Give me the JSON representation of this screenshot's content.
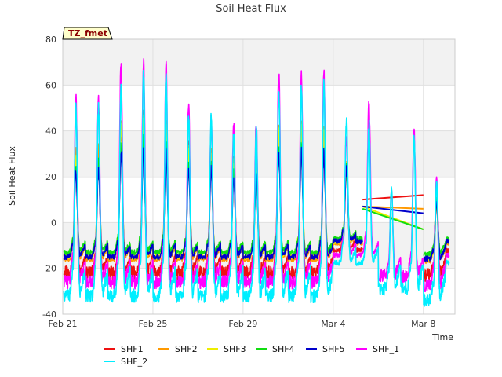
{
  "chart_data": {
    "type": "line",
    "title": "Soil Heat Flux",
    "xlabel": "Time",
    "ylabel": "Soil Heat Flux",
    "badge": "TZ_fmet",
    "xlim": [
      0,
      17.4
    ],
    "ylim": [
      -40,
      80
    ],
    "y_ticks": [
      -40,
      -20,
      0,
      20,
      40,
      60,
      80
    ],
    "x_ticks": [
      {
        "day": 0,
        "label": "Feb 21"
      },
      {
        "day": 4,
        "label": "Feb 25"
      },
      {
        "day": 8,
        "label": "Feb 29"
      },
      {
        "day": 12,
        "label": "Mar 4"
      },
      {
        "day": 16,
        "label": "Mar 8"
      }
    ],
    "grid": true,
    "legend_position": "bottom",
    "day_peaks": [
      {
        "day": 0,
        "SHF1": 28,
        "SHF2": 30,
        "SHF3": 28,
        "SHF4": 24,
        "SHF5": 23,
        "SHF_1": 54,
        "SHF_2": 50
      },
      {
        "day": 1,
        "SHF1": 30,
        "SHF2": 32,
        "SHF3": 30,
        "SHF4": 26,
        "SHF5": 24,
        "SHF_1": 55,
        "SHF_2": 51
      },
      {
        "day": 2,
        "SHF1": 42,
        "SHF2": 44,
        "SHF3": 42,
        "SHF4": 34,
        "SHF5": 31,
        "SHF_1": 70,
        "SHF_2": 60
      },
      {
        "day": 3,
        "SHF1": 47,
        "SHF2": 46,
        "SHF3": 44,
        "SHF4": 36,
        "SHF5": 33,
        "SHF_1": 70,
        "SHF_2": 65
      },
      {
        "day": 4,
        "SHF1": 45,
        "SHF2": 44,
        "SHF3": 42,
        "SHF4": 34,
        "SHF5": 32,
        "SHF_1": 68,
        "SHF_2": 66
      },
      {
        "day": 5,
        "SHF1": 34,
        "SHF2": 33,
        "SHF3": 30,
        "SHF4": 26,
        "SHF5": 24,
        "SHF_1": 53,
        "SHF_2": 47
      },
      {
        "day": 6,
        "SHF1": 30,
        "SHF2": 30,
        "SHF3": 28,
        "SHF4": 24,
        "SHF5": 23,
        "SHF_1": 45,
        "SHF_2": 46
      },
      {
        "day": 7,
        "SHF1": 26,
        "SHF2": 26,
        "SHF3": 24,
        "SHF4": 21,
        "SHF5": 20,
        "SHF_1": 44,
        "SHF_2": 38
      },
      {
        "day": 8,
        "SHF1": 28,
        "SHF2": 28,
        "SHF3": 26,
        "SHF4": 22,
        "SHF5": 21,
        "SHF_1": 44,
        "SHF_2": 43
      },
      {
        "day": 9,
        "SHF1": 42,
        "SHF2": 42,
        "SHF3": 40,
        "SHF4": 33,
        "SHF5": 30,
        "SHF_1": 66,
        "SHF_2": 58
      },
      {
        "day": 10,
        "SHF1": 43,
        "SHF2": 44,
        "SHF3": 42,
        "SHF4": 34,
        "SHF5": 31,
        "SHF_1": 64,
        "SHF_2": 60
      },
      {
        "day": 11,
        "SHF1": 40,
        "SHF2": 41,
        "SHF3": 39,
        "SHF4": 33,
        "SHF5": 31,
        "SHF_1": 65,
        "SHF_2": 60
      },
      {
        "day": 12,
        "SHF1": 25,
        "SHF2": 25,
        "SHF3": 24,
        "SHF4": 23,
        "SHF5": 24,
        "SHF_1": 38,
        "SHF_2": 45
      },
      {
        "day": 13,
        "SHF1": 20,
        "SHF2": 20,
        "SHF3": 20,
        "SHF4": 20,
        "SHF5": 20,
        "SHF_1": 52,
        "SHF_2": 43
      },
      {
        "day": 14,
        "SHF1": 9,
        "SHF2": 9,
        "SHF3": 9,
        "SHF4": 9,
        "SHF5": 9,
        "SHF_1": 14,
        "SHF_2": 15
      },
      {
        "day": 15,
        "SHF1": 10,
        "SHF2": 10,
        "SHF3": 10,
        "SHF4": 10,
        "SHF5": 10,
        "SHF_1": 41,
        "SHF_2": 38
      },
      {
        "day": 16,
        "SHF1": 10,
        "SHF2": 10,
        "SHF3": 10,
        "SHF4": 10,
        "SHF5": 10,
        "SHF_1": 20,
        "SHF_2": 18
      },
      {
        "day": 17,
        "SHF1": 22,
        "SHF2": 18,
        "SHF3": 17,
        "SHF4": 16,
        "SHF5": 16,
        "SHF_1": 45,
        "SHF_2": 37
      }
    ],
    "series": [
      {
        "name": "SHF1",
        "color": "#ee1111",
        "night_min": -22
      },
      {
        "name": "SHF2",
        "color": "#ff9900",
        "night_min": -16
      },
      {
        "name": "SHF3",
        "color": "#eeee00",
        "night_min": -15
      },
      {
        "name": "SHF4",
        "color": "#11dd11",
        "night_min": -13
      },
      {
        "name": "SHF5",
        "color": "#0000cc",
        "night_min": -15
      },
      {
        "name": "SHF_1",
        "color": "#ff00ff",
        "night_min": -26
      },
      {
        "name": "SHF_2",
        "color": "#00eeff",
        "night_min": -32
      }
    ],
    "gap_segments": [
      {
        "series": "SHF1",
        "x": [
          13.3,
          16.0
        ],
        "y": [
          10,
          12
        ]
      },
      {
        "series": "SHF2",
        "x": [
          13.3,
          16.0
        ],
        "y": [
          7,
          6
        ]
      },
      {
        "series": "SHF3",
        "x": [
          13.3,
          16.0
        ],
        "y": [
          7,
          -3
        ]
      },
      {
        "series": "SHF4",
        "x": [
          13.3,
          16.0
        ],
        "y": [
          6,
          -3
        ]
      },
      {
        "series": "SHF5",
        "x": [
          13.3,
          16.0
        ],
        "y": [
          7,
          4
        ]
      }
    ]
  }
}
